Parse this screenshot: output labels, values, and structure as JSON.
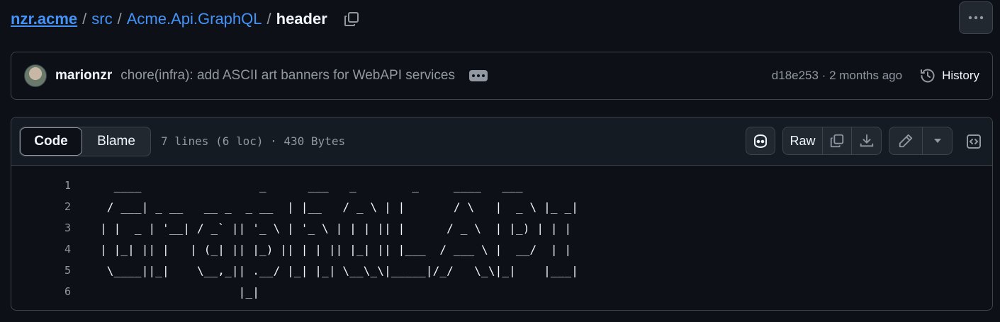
{
  "breadcrumb": {
    "repo": "nzr.acme",
    "separator": "/",
    "parts": [
      "src",
      "Acme.Api.GraphQL"
    ],
    "current": "header"
  },
  "commit": {
    "author": "marionzr",
    "message": "chore(infra): add ASCII art banners for WebAPI services",
    "meta": "d18e253 · 2 months ago",
    "history_label": "History"
  },
  "file": {
    "tabs": {
      "code": "Code",
      "blame": "Blame"
    },
    "info": "7 lines (6 loc) · 430 Bytes",
    "raw_label": "Raw"
  },
  "code_lines": [
    {
      "num": "1",
      "text": "  ____                 _      ___   _        _     ____   ___ "
    },
    {
      "num": "2",
      "text": " / ___| _ __   __ _  _ __  | |__   / _ \\ | |       / \\   |  _ \\ |_ _|"
    },
    {
      "num": "3",
      "text": "| |  _ | '__| / _` || '_ \\ | '_ \\ | | | || |      / _ \\  | |_) | | | "
    },
    {
      "num": "4",
      "text": "| |_| || |   | (_| || |_) || | | || |_| || |___  / ___ \\ |  __/  | | "
    },
    {
      "num": "5",
      "text": " \\____||_|    \\__,_|| .__/ |_| |_| \\__\\_\\|_____|/_/   \\_\\|_|    |___|"
    },
    {
      "num": "6",
      "text": "                    |_|                                           "
    }
  ],
  "colors": {
    "background": "#0d1117",
    "link": "#4493f8",
    "muted": "#9198a1",
    "border": "#3d444d",
    "text": "#f0f6fc"
  }
}
